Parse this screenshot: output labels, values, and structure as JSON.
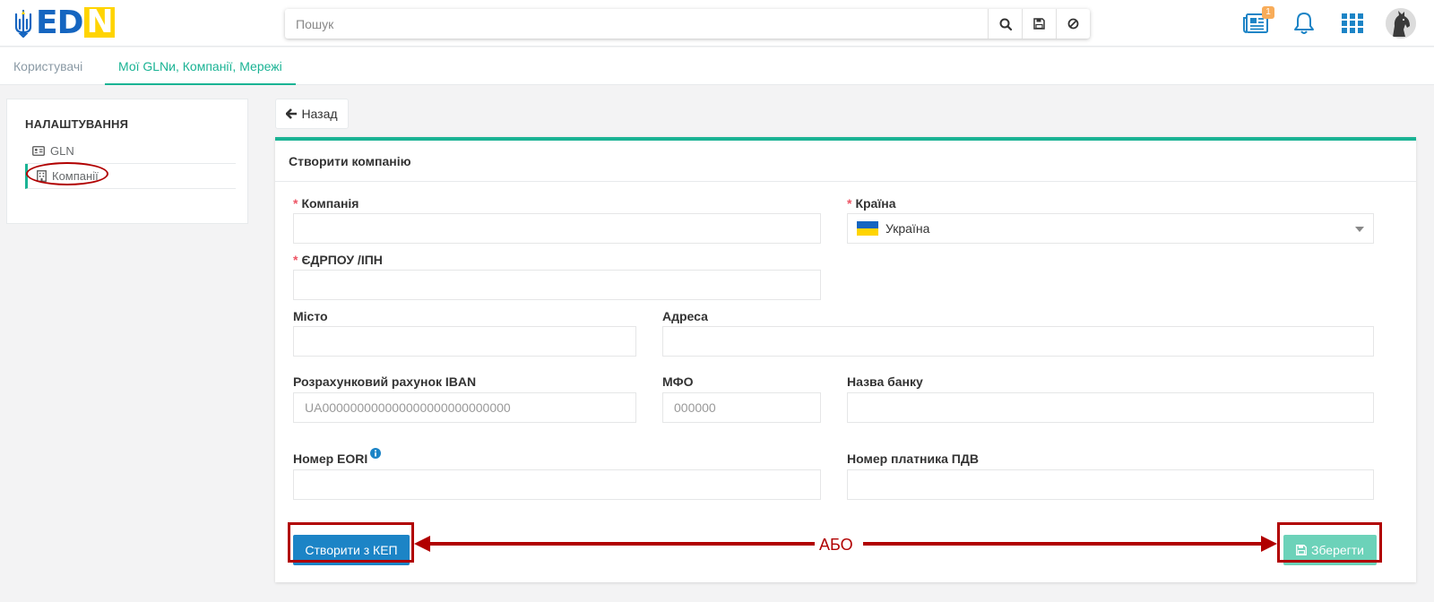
{
  "logo": {
    "text_e": "E",
    "text_d": "D",
    "text_n": "N"
  },
  "search": {
    "placeholder": "Пошук"
  },
  "header": {
    "notifications_badge": "1"
  },
  "tabs": {
    "users": "Користувачі",
    "gln": "Мої GLNи, Компанії, Мережі"
  },
  "sidebar": {
    "title": "НАЛАШТУВАННЯ",
    "items": [
      "GLN",
      "Компанії"
    ]
  },
  "back_label": "Назад",
  "panel": {
    "title": "Створити компанію"
  },
  "form": {
    "company_label": "Компанія",
    "country_label": "Країна",
    "country_value": "Україна",
    "edrpou_label": "ЄДРПОУ /ІПН",
    "city_label": "Місто",
    "address_label": "Адреса",
    "iban_label": "Розрахунковий рахунок IBAN",
    "iban_placeholder": "UA000000000000000000000000000",
    "mfo_label": "МФО",
    "mfo_placeholder": "000000",
    "bank_label": "Назва банку",
    "eori_label": "Номер EORI",
    "vat_label": "Номер платника ПДВ",
    "required_mark": "*"
  },
  "buttons": {
    "create_kep": "Створити з КЕП",
    "save": "Зберегти"
  },
  "annotation": {
    "or_label": "АБО"
  },
  "colors": {
    "accent": "#1ab394",
    "primary_btn": "#1c84c6",
    "save_btn": "#6cd2b9",
    "annotation_red": "#b10000"
  }
}
